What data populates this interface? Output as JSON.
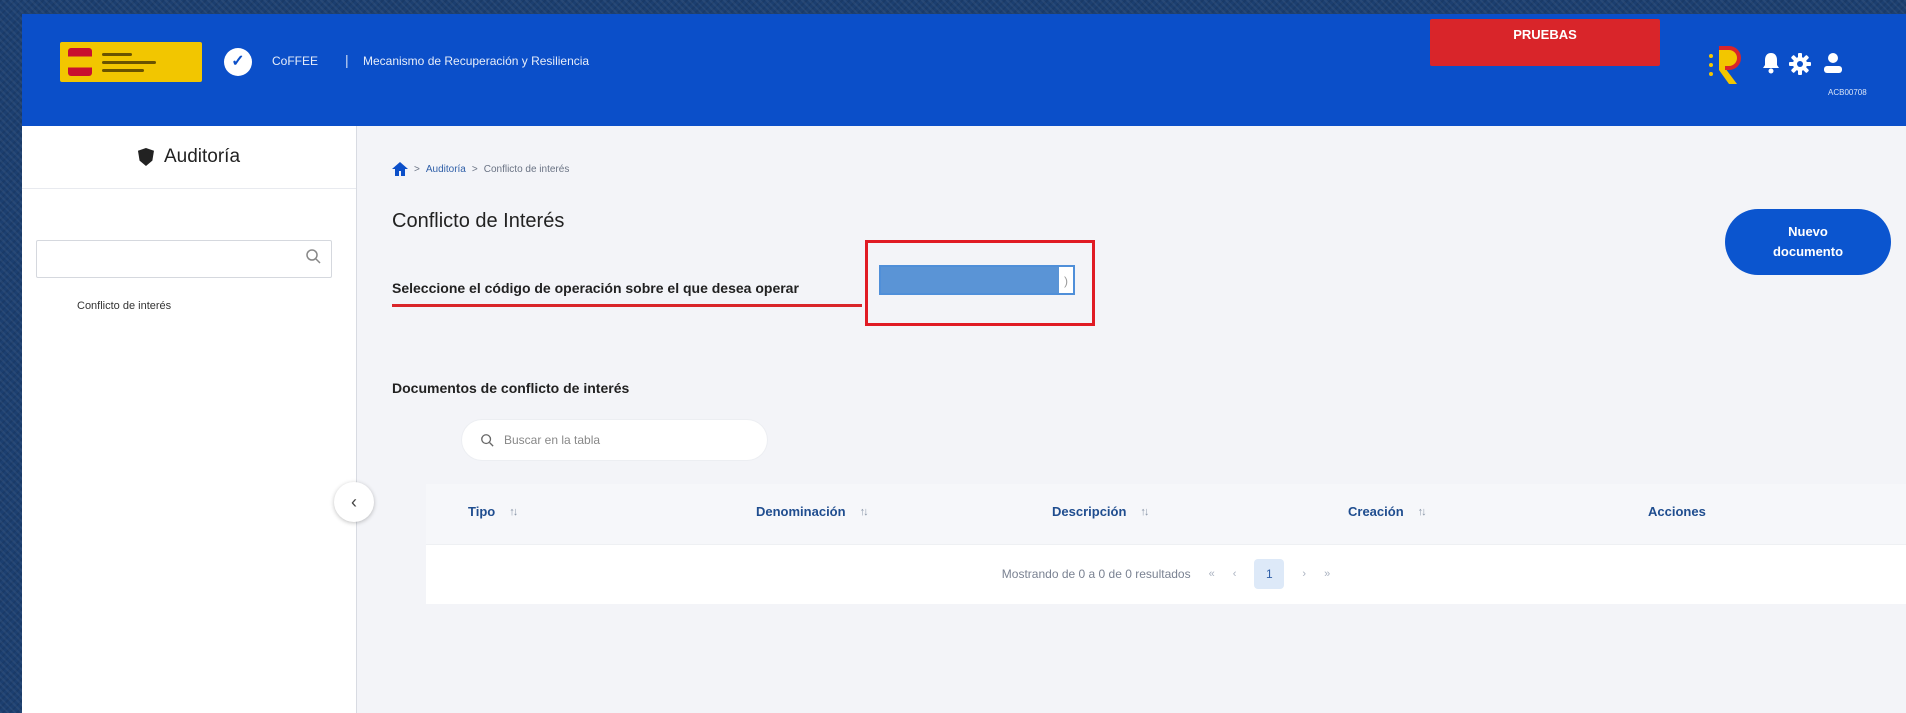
{
  "header": {
    "app_name": "CoFFEE",
    "separator": "|",
    "app_subtitle": "Mecanismo de Recuperación y Resiliencia",
    "environment_badge": "PRUEBAS",
    "icons": [
      "notification-bell-icon",
      "settings-gear-icon",
      "user-icon"
    ],
    "user_code": "ACB00708"
  },
  "sidebar": {
    "title": "Auditoría",
    "items": [
      {
        "label": "Conflicto de interés"
      }
    ]
  },
  "breadcrumb": {
    "items": [
      "Auditoría",
      "Conflicto de interés"
    ],
    "separator": ">"
  },
  "main": {
    "page_title": "Conflicto de Interés",
    "operation_label": "Seleccione el código de operación sobre el que desea operar",
    "new_document_button": "Nuevo documento",
    "documents_title": "Documentos de conflicto de interés",
    "table_search_placeholder": "Buscar en la tabla"
  },
  "table": {
    "columns": [
      "Tipo",
      "Denominación",
      "Descripción",
      "Creación",
      "Acciones"
    ],
    "rows": [],
    "pagination": {
      "summary": "Mostrando de 0 a 0 de 0 resultados",
      "first": "«",
      "prev": "‹",
      "current_page": "1",
      "next": "›",
      "last": "»"
    }
  },
  "colors": {
    "header_bg": "#0b4fc9",
    "badge_red": "#d9252a",
    "primary_button": "#0b55cf",
    "highlight_red": "#e01b24"
  }
}
